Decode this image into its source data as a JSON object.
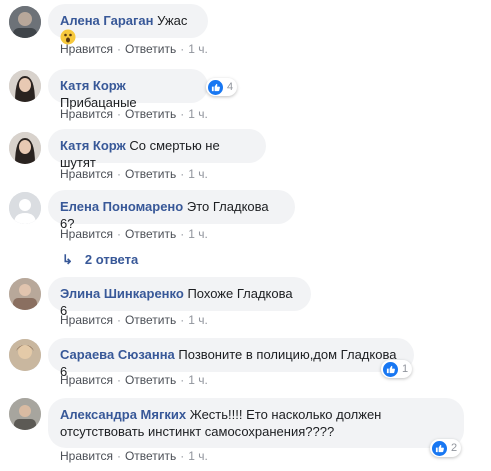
{
  "comments": [
    {
      "name": "Алена Гараган",
      "text": "Ужас",
      "emoji": "wow-emoji",
      "like": "Нравится",
      "reply": "Ответить",
      "time": "1 ч."
    },
    {
      "name": "Катя Корж",
      "text": "Прибацаные",
      "like": "Нравится",
      "reply": "Ответить",
      "time": "1 ч.",
      "reactions": "4"
    },
    {
      "name": "Катя Корж",
      "text": "Со смертью не шутят",
      "like": "Нравится",
      "reply": "Ответить",
      "time": "1 ч."
    },
    {
      "name": "Елена Пономарено",
      "text": "Это Гладкова 6?",
      "like": "Нравится",
      "reply": "Ответить",
      "time": "1 ч."
    },
    {
      "name": "Элина Шинкаренко",
      "text": "Похоже Гладкова 6",
      "like": "Нравится",
      "reply": "Ответить",
      "time": "1 ч."
    },
    {
      "name": "Сараева Сюзанна",
      "text": "Позвоните в полицию,дом Гладкова 6",
      "like": "Нравится",
      "reply": "Ответить",
      "time": "1 ч.",
      "reactions": "1"
    },
    {
      "name": "Александра Мягких",
      "text_line1": "Жесть!!!! Ето насколько должен",
      "text_line2": "отсутствовать инстинкт самосохранения????",
      "like": "Нравится",
      "reply": "Ответить",
      "time": "1 ч.",
      "reactions": "2"
    }
  ],
  "replies_link": "2 ответа",
  "colors": {
    "name": "#385898",
    "bubble": "#f2f3f5",
    "meta": "#90949c",
    "like": "#1877f2"
  },
  "icons": {
    "like": "thumbs-up-icon",
    "reply_arrow": "reply-arrow-icon",
    "wow": "wow-emoji"
  }
}
